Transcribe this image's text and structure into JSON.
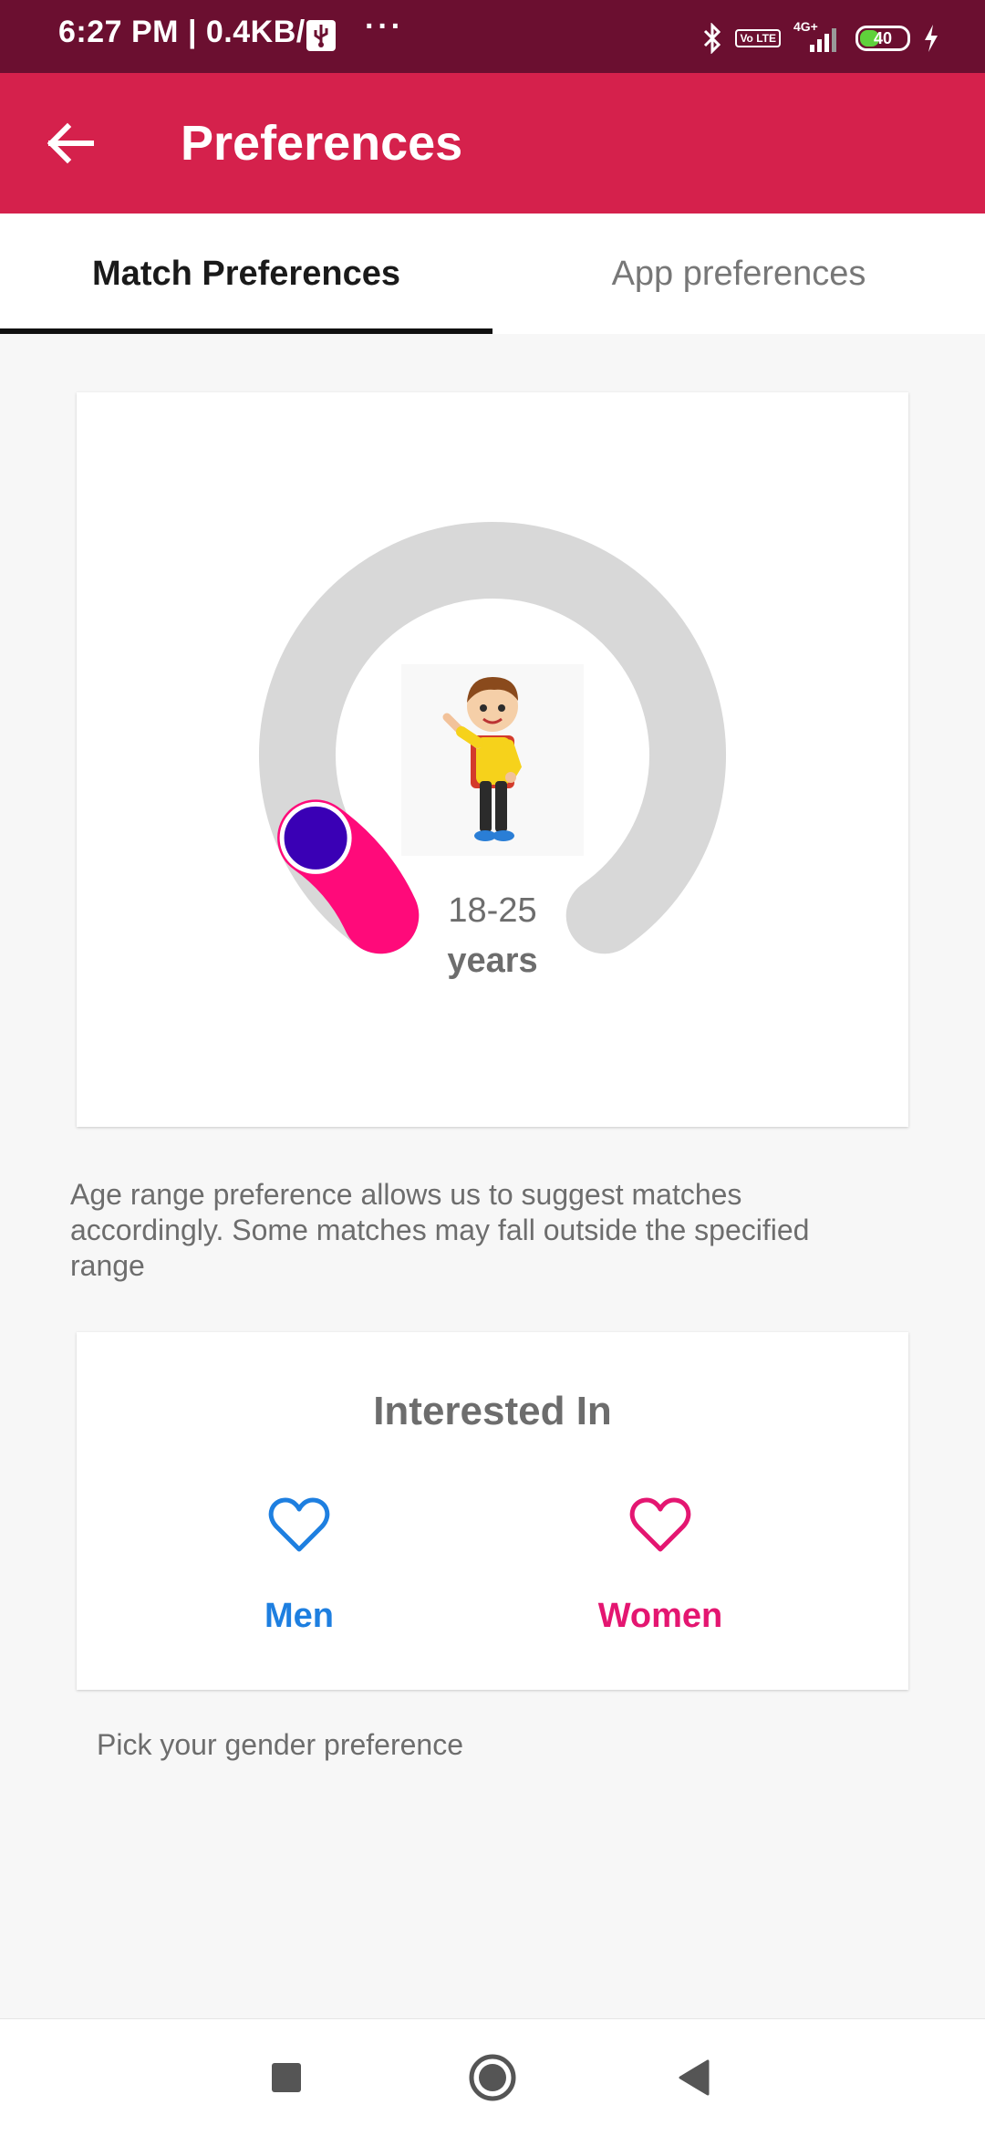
{
  "status_bar": {
    "time_speed": "6:27 PM | 0.4KB/s",
    "dots": "···",
    "volte": "Vo LTE",
    "network": "4G+",
    "battery": "40",
    "battery_level_percent": 40
  },
  "app_bar": {
    "title": "Preferences",
    "back_icon": "arrow-left-icon"
  },
  "tabs": [
    {
      "label": "Match Preferences",
      "selected": true
    },
    {
      "label": "App preferences",
      "selected": false
    }
  ],
  "age_range": {
    "range_text": "18-25",
    "unit": "years",
    "min_age": 18,
    "max_age": 25,
    "track_color": "#d8d8d8",
    "active_color": "#ff0a7a",
    "thumb_color": "#3a00b5",
    "description": "Age range preference allows us to suggest matches accordingly. Some matches may fall outside the specified range"
  },
  "interested_in": {
    "title": "Interested In",
    "options": [
      {
        "label": "Men",
        "icon": "heart-outline-icon",
        "color": "#1e7fe0"
      },
      {
        "label": "Women",
        "icon": "heart-outline-icon",
        "color": "#e41671"
      }
    ],
    "description": "Pick your gender preference"
  },
  "nav_bar": {
    "buttons": [
      "recents-square-icon",
      "home-circle-icon",
      "back-triangle-icon"
    ]
  },
  "colors": {
    "status_bar": "#6b0f30",
    "app_bar": "#d5214c"
  }
}
